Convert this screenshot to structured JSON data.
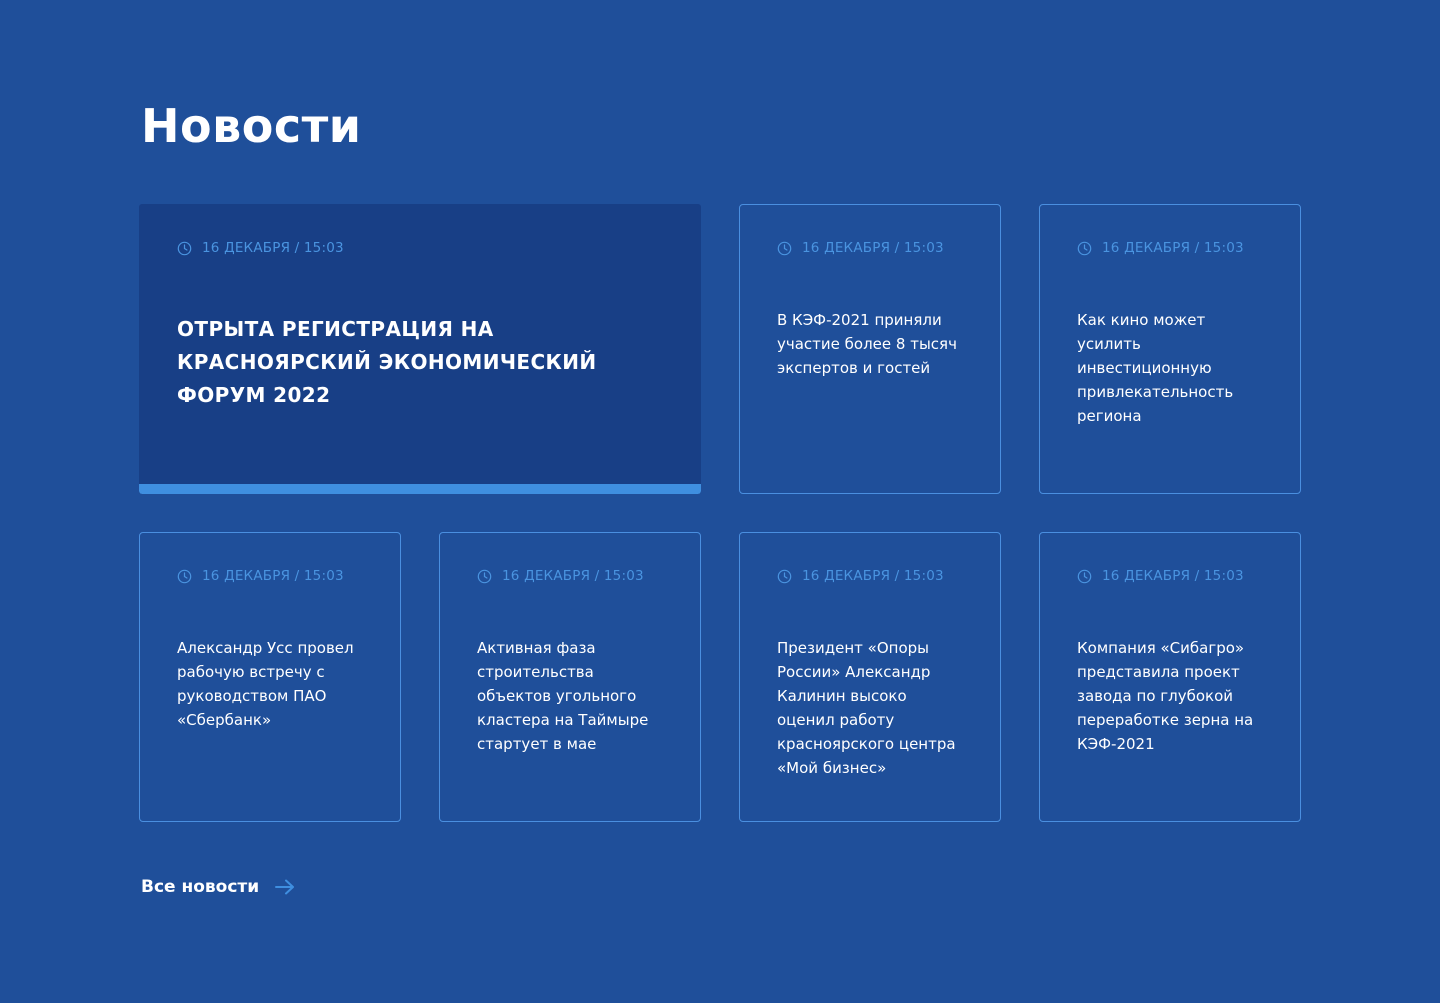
{
  "section": {
    "title": "Новости"
  },
  "news": [
    {
      "date": "16 ДЕКАБРЯ / 15:03",
      "title": "Отрыта регистрация на Красноярский экономический форум 2022",
      "featured": true
    },
    {
      "date": "16 ДЕКАБРЯ / 15:03",
      "title": "В КЭФ-2021 приняли участие более 8 тысяч экспертов и гостей"
    },
    {
      "date": "16 ДЕКАБРЯ / 15:03",
      "title": "Как кино может усилить инвестиционную привлекательность региона"
    },
    {
      "date": "16 ДЕКАБРЯ / 15:03",
      "title": "Александр Усс провел рабочую встречу с руководством ПАО «Сбербанк»"
    },
    {
      "date": "16 ДЕКАБРЯ / 15:03",
      "title": "Активная фаза строительства объектов угольного кластера на Таймыре стартует в мае"
    },
    {
      "date": "16 ДЕКАБРЯ / 15:03",
      "title": "Президент «Опоры России» Александр Калинин высоко оценил работу красноярского центра «Мой бизнес»"
    },
    {
      "date": "16 ДЕКАБРЯ / 15:03",
      "title": "Компания «Сибагро» представила проект завода по глубокой переработке зерна на КЭФ-2021"
    }
  ],
  "footer": {
    "all_news_label": "Все новости",
    "arrow_icon": "arrow-right-icon"
  },
  "colors": {
    "background": "#1f4f9a",
    "featured_card": "#183f86",
    "accent": "#3f8fe0",
    "date_text": "#4a94e0",
    "card_border": "#4a8fe0"
  },
  "icons": {
    "date": "clock-icon"
  }
}
